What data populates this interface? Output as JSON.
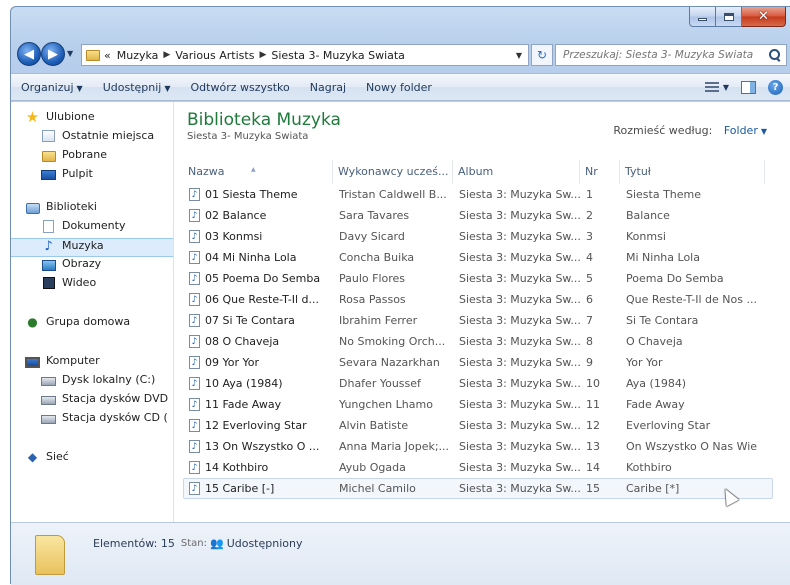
{
  "window": {
    "caption_buttons": {
      "minimize": "",
      "maximize": "",
      "close": "✕"
    }
  },
  "navbar": {
    "breadcrumbs": [
      "«",
      "Muzyka",
      "Various Artists",
      "Siesta 3- Muzyka Swiata"
    ],
    "search_placeholder": "Przeszukaj: Siesta 3- Muzyka Swiata"
  },
  "toolbar": {
    "organize": "Organizuj",
    "share": "Udostępnij",
    "play_all": "Odtwórz wszystko",
    "burn": "Nagraj",
    "new_folder": "Nowy folder"
  },
  "sidebar": {
    "favorites": {
      "title": "Ulubione",
      "items": [
        "Ostatnie miejsca",
        "Pobrane",
        "Pulpit"
      ]
    },
    "libraries": {
      "title": "Biblioteki",
      "items": [
        "Dokumenty",
        "Muzyka",
        "Obrazy",
        "Wideo"
      ],
      "selected": "Muzyka"
    },
    "homegroup": "Grupa domowa",
    "computer": {
      "title": "Komputer",
      "items": [
        "Dysk lokalny (C:)",
        "Stacja dysków DVD",
        "Stacja dysków CD ("
      ]
    },
    "network": "Sieć"
  },
  "library": {
    "title": "Biblioteka Muzyka",
    "subtitle": "Siesta 3- Muzyka Swiata",
    "arrange_label": "Rozmieść według:",
    "arrange_value": "Folder"
  },
  "table": {
    "columns": [
      "Nazwa",
      "Wykonawcy ucześ...",
      "Album",
      "Nr",
      "Tytuł"
    ],
    "rows": [
      [
        "01 Siesta Theme",
        "Tristan Caldwell B...",
        "Siesta 3: Muzyka Sw...",
        "1",
        "Siesta Theme"
      ],
      [
        "02 Balance",
        "Sara Tavares",
        "Siesta 3: Muzyka Sw...",
        "2",
        "Balance"
      ],
      [
        "03 Konmsi",
        "Davy Sicard",
        "Siesta 3: Muzyka Sw...",
        "3",
        "Konmsi"
      ],
      [
        "04 Mi Ninha Lola",
        "Concha Buika",
        "Siesta 3: Muzyka Sw...",
        "4",
        "Mi Ninha Lola"
      ],
      [
        "05 Poema Do Semba",
        "Paulo Flores",
        "Siesta 3: Muzyka Sw...",
        "5",
        "Poema Do Semba"
      ],
      [
        "06 Que Reste-T-Il d...",
        "Rosa Passos",
        "Siesta 3: Muzyka Sw...",
        "6",
        "Que Reste-T-Il de Nos ..."
      ],
      [
        "07 Si Te Contara",
        "Ibrahim Ferrer",
        "Siesta 3: Muzyka Sw...",
        "7",
        "Si Te Contara"
      ],
      [
        "08 O Chaveja",
        "No Smoking Orch...",
        "Siesta 3: Muzyka Sw...",
        "8",
        "O Chaveja"
      ],
      [
        "09 Yor Yor",
        "Sevara Nazarkhan",
        "Siesta 3: Muzyka Sw...",
        "9",
        "Yor Yor"
      ],
      [
        "10 Aya (1984)",
        "Dhafer Youssef",
        "Siesta 3: Muzyka Sw...",
        "10",
        "Aya (1984)"
      ],
      [
        "11 Fade Away",
        "Yungchen Lhamo",
        "Siesta 3: Muzyka Sw...",
        "11",
        "Fade Away"
      ],
      [
        "12 Everloving Star",
        "Alvin Batiste",
        "Siesta 3: Muzyka Sw...",
        "12",
        "Everloving Star"
      ],
      [
        "13 On Wszystko O ...",
        "Anna Maria Jopek;...",
        "Siesta 3: Muzyka Sw...",
        "13",
        "On Wszystko O Nas Wie"
      ],
      [
        "14 Kothbiro",
        "Ayub Ogada",
        "Siesta 3: Muzyka Sw...",
        "14",
        "Kothbiro"
      ],
      [
        "15 Caribe [-]",
        "Michel Camilo",
        "Siesta 3: Muzyka Sw...",
        "15",
        "Caribe [*]"
      ]
    ],
    "selected_row": 14
  },
  "status": {
    "items": "Elementów: 15",
    "state_label": "Stan:",
    "state_value": "Udostępniony"
  }
}
